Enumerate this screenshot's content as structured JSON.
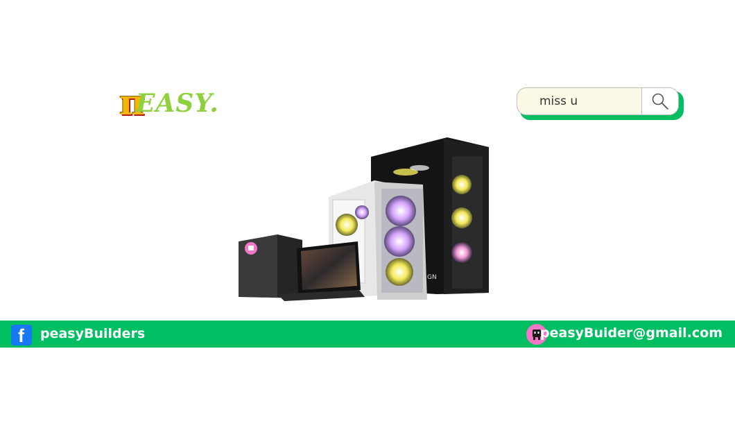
{
  "logo": {
    "symbol": "π",
    "text": "EASY."
  },
  "search": {
    "value": "miss u",
    "icon": "search-icon"
  },
  "hero": {
    "icon": "gaming-pc-product-image",
    "monitor_brand_label": "GN"
  },
  "footer": {
    "facebook_icon_glyph": "f",
    "facebook_label": "peasyBuilders",
    "email_icon": "mail-robot-icon",
    "email_label": "peasyBuider@gmail.com"
  },
  "colors": {
    "brand_green": "#00bf63",
    "logo_green": "#8ed13c",
    "logo_yellow": "#f2b705",
    "facebook_blue": "#1877f2",
    "email_pink": "#f277c6",
    "search_bg": "#fdf9e7"
  }
}
